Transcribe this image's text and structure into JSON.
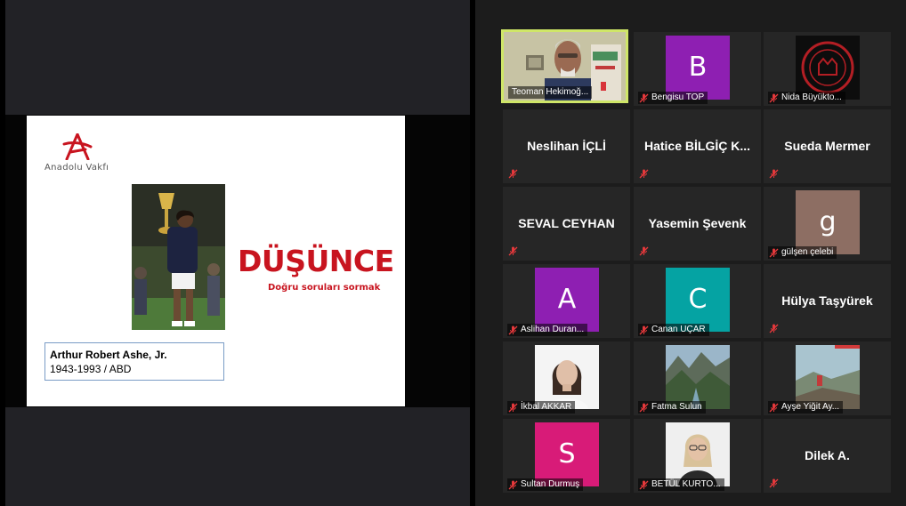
{
  "presentation": {
    "logo_text": "Anadolu Vakfı",
    "title": "DÜŞÜNCE",
    "subtitle": "Doğru soruları sormak",
    "caption_name": "Arthur Robert Ashe, Jr.",
    "caption_years": "1943-1993 / ABD"
  },
  "participants": [
    {
      "name": "Teoman Hekimoğ...",
      "kind": "video",
      "active": true
    },
    {
      "name": "Bengisu TOP",
      "kind": "avatar",
      "initial": "B",
      "color": "#8e1fb2",
      "muted": true
    },
    {
      "name": "Nida Büyükto...",
      "kind": "emblem",
      "muted": true
    },
    {
      "name": "Neslihan İÇLİ",
      "kind": "text",
      "muted": true
    },
    {
      "name": "Hatice BİLGİÇ K...",
      "kind": "text",
      "muted": true
    },
    {
      "name": "Sueda Mermer",
      "kind": "text",
      "muted": true
    },
    {
      "name": "SEVAL CEYHAN",
      "kind": "text",
      "muted": true
    },
    {
      "name": "Yasemin Şevenk",
      "kind": "text",
      "muted": true
    },
    {
      "name": "gülşen çelebi",
      "kind": "avatar",
      "initial": "g",
      "color": "#8d6e63",
      "muted": true
    },
    {
      "name": "Aslihan Duran...",
      "kind": "avatar",
      "initial": "A",
      "color": "#8e1fb2",
      "muted": true
    },
    {
      "name": "Canan UÇAR",
      "kind": "avatar",
      "initial": "C",
      "color": "#05a3a3",
      "muted": true
    },
    {
      "name": "Hülya Taşyürek",
      "kind": "text",
      "muted": true
    },
    {
      "name": "İkbal AKKAR",
      "kind": "photo",
      "muted": true
    },
    {
      "name": "Fatma Sulun",
      "kind": "photo",
      "muted": true
    },
    {
      "name": "Ayşe Yiğit Ay...",
      "kind": "photo",
      "muted": true
    },
    {
      "name": "Sultan Durmuş",
      "kind": "avatar",
      "initial": "S",
      "color": "#d81b78",
      "muted": true
    },
    {
      "name": "BETÜL KURTO...",
      "kind": "photo",
      "muted": true
    },
    {
      "name": "Dilek A.",
      "kind": "text",
      "muted": true
    }
  ]
}
